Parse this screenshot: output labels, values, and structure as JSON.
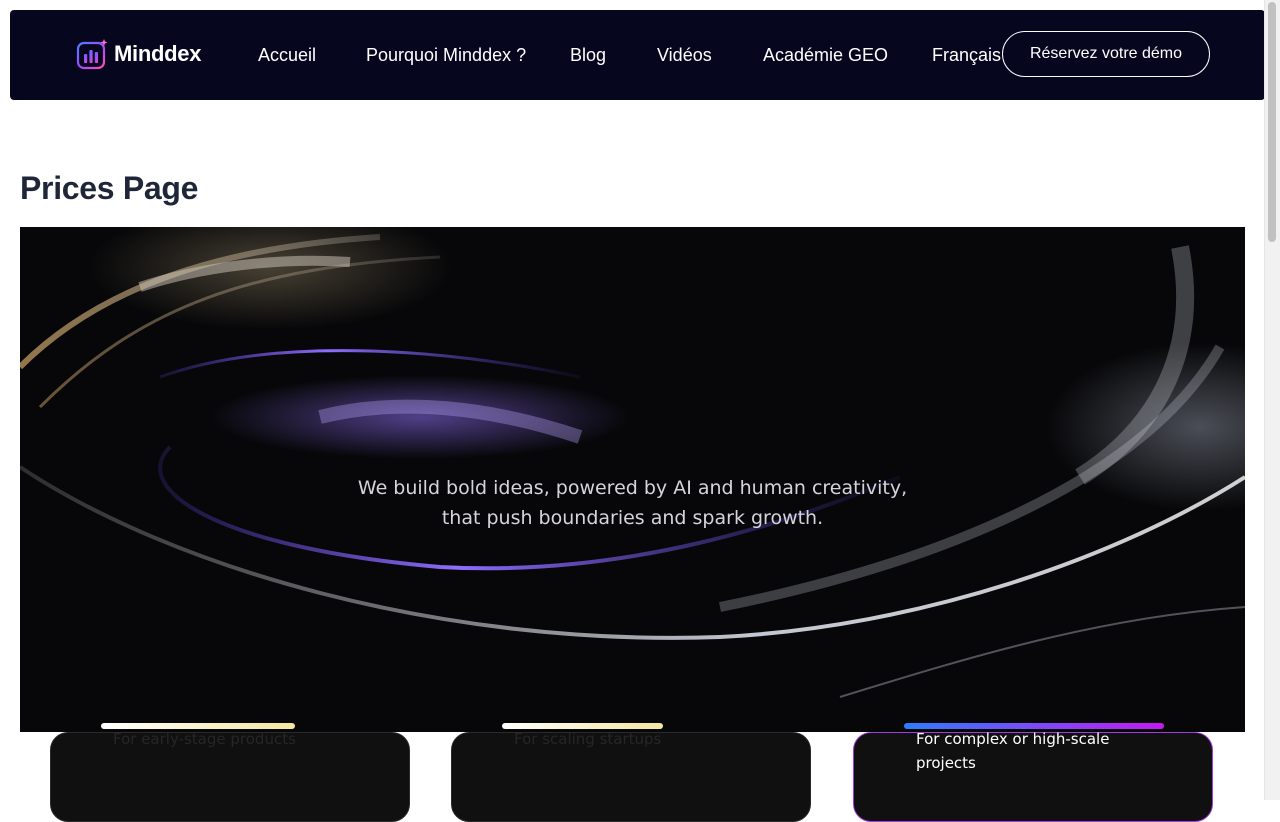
{
  "nav": {
    "logo_text": "Minddex",
    "items": [
      {
        "label": "Accueil"
      },
      {
        "label": "Pourquoi Minddex ?"
      },
      {
        "label": "Blog"
      },
      {
        "label": "Vidéos"
      },
      {
        "label": "Académie GEO"
      },
      {
        "label": "Français"
      }
    ],
    "cta_label": "Réservez votre démo"
  },
  "page": {
    "title": "Prices Page"
  },
  "hero": {
    "line1": "We build bold ideas, powered by AI and human creativity,",
    "line2": "that push boundaries and spark growth."
  },
  "cards": [
    {
      "description": "For early-stage products"
    },
    {
      "description": "For scaling startups"
    },
    {
      "description": "For complex or high-scale projects"
    }
  ],
  "colors": {
    "nav_bg": "#06061f",
    "title": "#1e2638",
    "card_bg": "#101010",
    "card3_border": "#a23be3"
  },
  "icons": {
    "logo": "bar-chart-sparkle-icon"
  }
}
